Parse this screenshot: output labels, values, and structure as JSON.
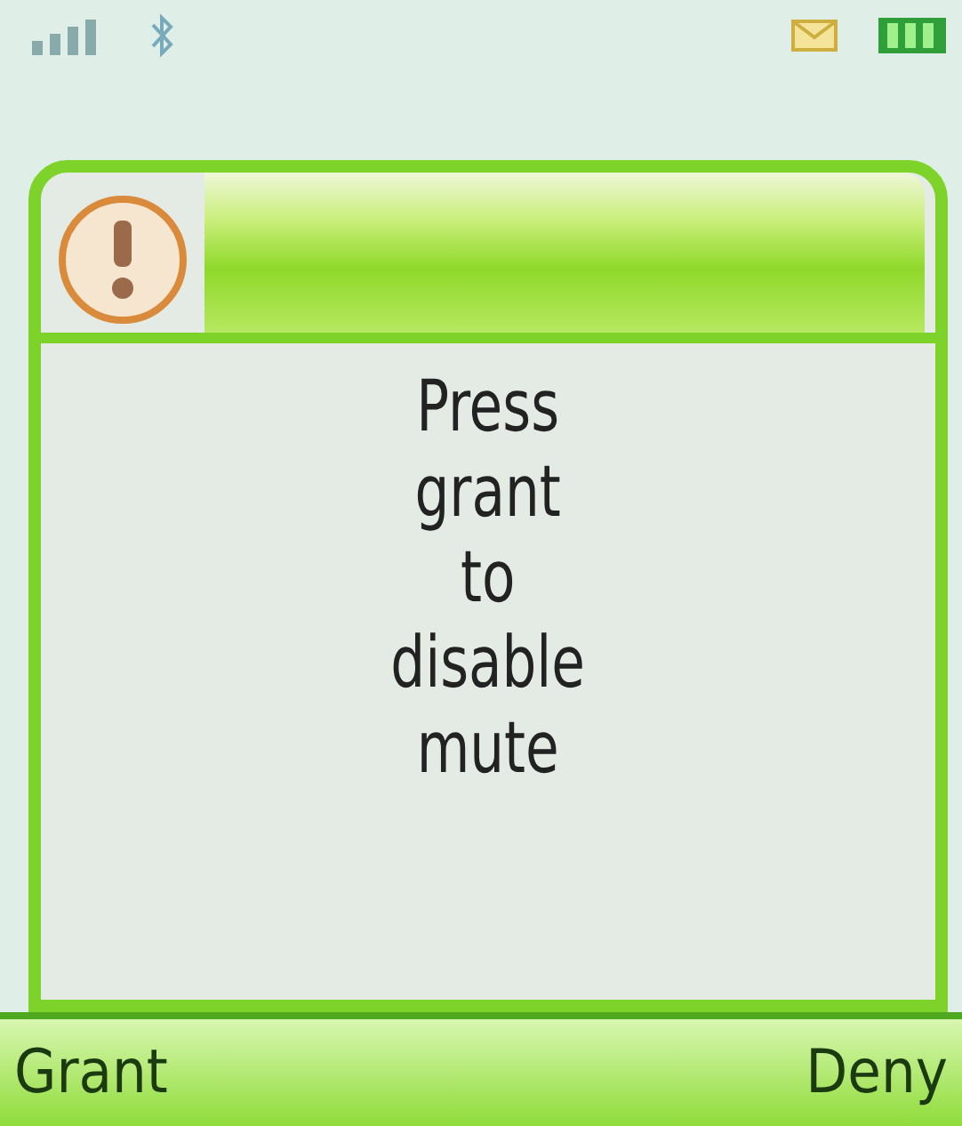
{
  "dialog": {
    "message": "Press grant to disable mute"
  },
  "softkeys": [
    {
      "label": "Grant"
    },
    {
      "label": "Deny"
    }
  ]
}
